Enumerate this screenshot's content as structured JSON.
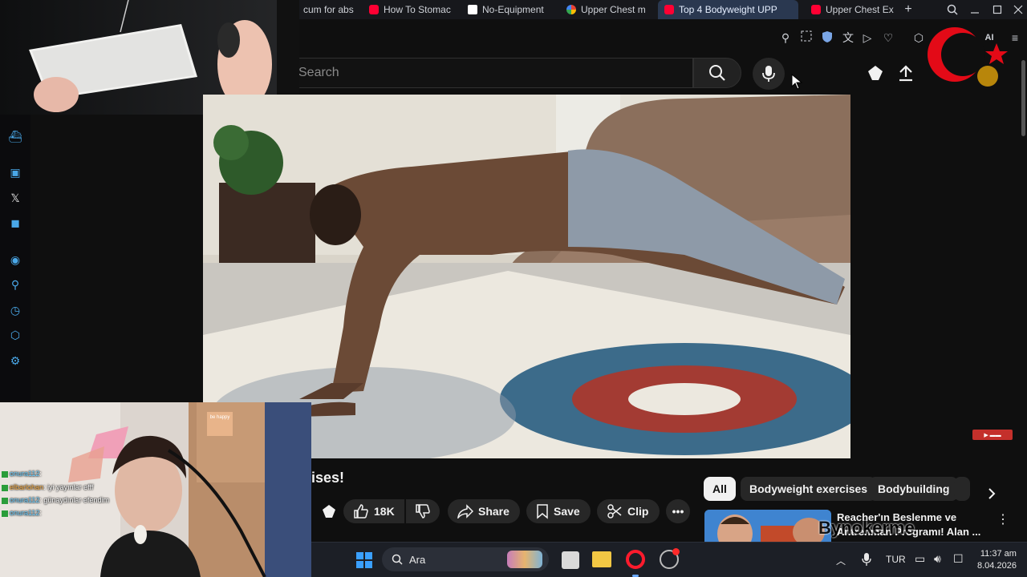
{
  "browser": {
    "tabs": [
      {
        "label": "cum for abs",
        "favicon": "none"
      },
      {
        "label": "How To Stomac",
        "favicon": "youtube-favicon"
      },
      {
        "label": "No-Equipment",
        "favicon": "notion-favicon"
      },
      {
        "label": "Upper Chest m",
        "favicon": "google-favicon"
      },
      {
        "label": "Top 4 Bodyweight UPP",
        "favicon": "youtube-favicon",
        "active": true
      },
      {
        "label": "Upper Chest Ex",
        "favicon": "youtube-favicon"
      }
    ],
    "new_tab_label": "+",
    "toolbar_ai_label": "AI"
  },
  "youtube": {
    "search_placeholder": "Search",
    "title_fragment": "ises!",
    "actions": {
      "like_count": "18K",
      "share_label": "Share",
      "save_label": "Save",
      "clip_label": "Clip",
      "more_label": "•••"
    },
    "chips": [
      {
        "label": "All",
        "active": true
      },
      {
        "label": "Bodyweight exercises"
      },
      {
        "label": "Bodybuilding"
      }
    ],
    "recommended": {
      "title": "Reacher'ın Beslenme ve",
      "subtitle": "Antrenman Programı! Alan ...",
      "overlay_text": "Bynokerme"
    }
  },
  "stream_chat": [
    {
      "user": "onura112",
      "message": ""
    },
    {
      "user": "elbarlohan",
      "message": "iyi yayınlar efff"
    },
    {
      "user": "onura112",
      "message": "günaydınlar efendim"
    },
    {
      "user": "onura112",
      "message": ""
    }
  ],
  "webcam": {
    "wall_sign": "be happy"
  },
  "taskbar": {
    "search_label": "Ara",
    "language": "TUR",
    "time": "11:37 am",
    "date": "8.04.2026"
  },
  "colors": {
    "accent_youtube": "#ff0033",
    "active_tab": "#2a3850",
    "background": "#0f0f0f"
  }
}
